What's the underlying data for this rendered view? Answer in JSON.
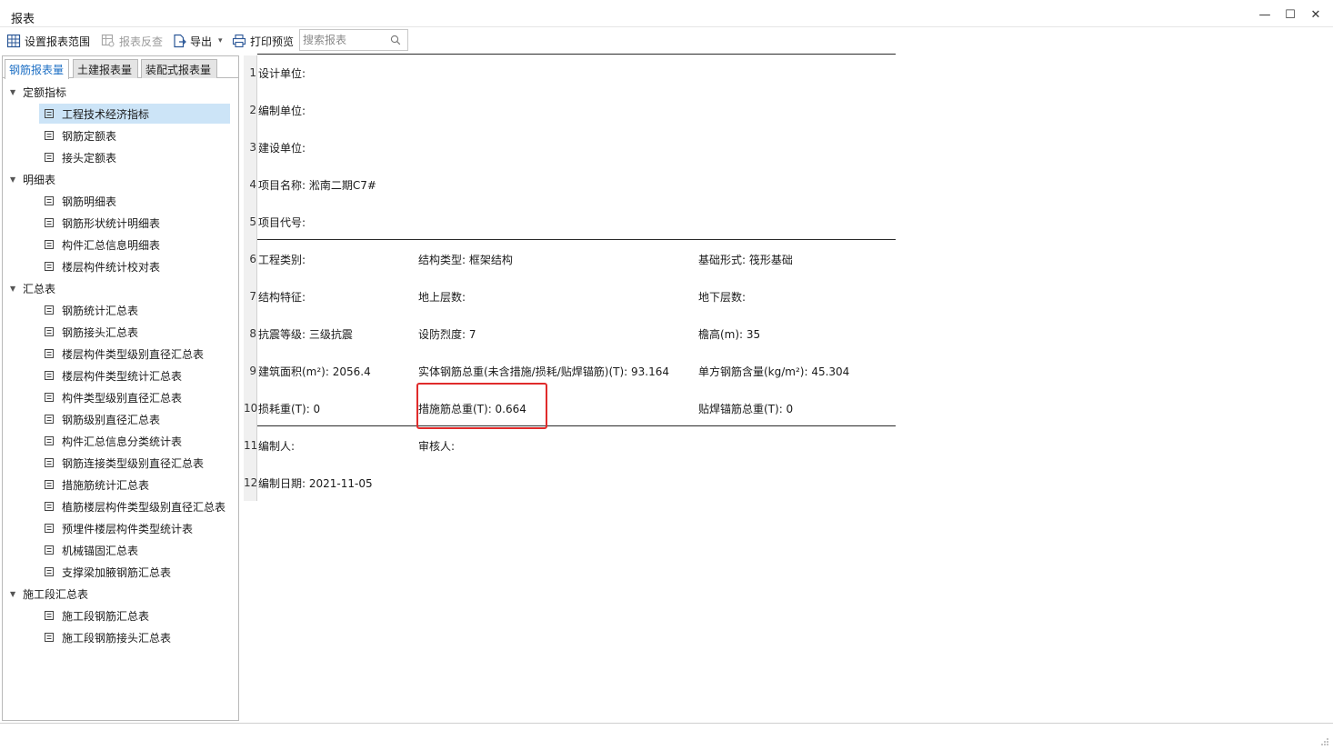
{
  "window": {
    "title": "报表",
    "min_label": "—",
    "max_label": "☐",
    "close_label": "✕"
  },
  "toolbar": {
    "set_range": "设置报表范围",
    "reverse_check": "报表反查",
    "export": "导出",
    "export_caret": "▾",
    "print_preview": "打印预览",
    "search_placeholder": "搜索报表"
  },
  "tabs": [
    {
      "label": "钢筋报表量",
      "active": true
    },
    {
      "label": "土建报表量",
      "active": false
    },
    {
      "label": "装配式报表量",
      "active": false
    }
  ],
  "tree": {
    "groups": [
      {
        "label": "定额指标",
        "items": [
          "工程技术经济指标",
          "钢筋定额表",
          "接头定额表"
        ]
      },
      {
        "label": "明细表",
        "items": [
          "钢筋明细表",
          "钢筋形状统计明细表",
          "构件汇总信息明细表",
          "楼层构件统计校对表"
        ]
      },
      {
        "label": "汇总表",
        "items": [
          "钢筋统计汇总表",
          "钢筋接头汇总表",
          "楼层构件类型级别直径汇总表",
          "楼层构件类型统计汇总表",
          "构件类型级别直径汇总表",
          "钢筋级别直径汇总表",
          "构件汇总信息分类统计表",
          "钢筋连接类型级别直径汇总表",
          "措施筋统计汇总表",
          "植筋楼层构件类型级别直径汇总表",
          "预埋件楼层构件类型统计表",
          "机械锚固汇总表",
          "支撑梁加腋钢筋汇总表"
        ]
      },
      {
        "label": "施工段汇总表",
        "items": [
          "施工段钢筋汇总表",
          "施工段钢筋接头汇总表"
        ]
      }
    ],
    "selected": "工程技术经济指标"
  },
  "report": {
    "row_numbers": [
      "1",
      "2",
      "3",
      "4",
      "5",
      "6",
      "7",
      "8",
      "9",
      "10",
      "11",
      "12"
    ],
    "r1_c1": "设计单位:",
    "r2_c1": "编制单位:",
    "r3_c1": "建设单位:",
    "r4_c1": "项目名称: 淞南二期C7#",
    "r5_c1": "项目代号:",
    "r6_c1": "工程类别:",
    "r6_c2": "结构类型: 框架结构",
    "r6_c3": "基础形式: 筏形基础",
    "r7_c1": "结构特征:",
    "r7_c2": "地上层数:",
    "r7_c3": "地下层数:",
    "r8_c1": "抗震等级: 三级抗震",
    "r8_c2": "设防烈度: 7",
    "r8_c3": "檐高(m): 35",
    "r9_c1": "建筑面积(m²): 2056.4",
    "r9_c2": "实体钢筋总重(未含措施/损耗/贴焊锚筋)(T): 93.164",
    "r9_c3": "单方钢筋含量(kg/m²): 45.304",
    "r10_c1": "损耗重(T): 0",
    "r10_c2": "措施筋总重(T): 0.664",
    "r10_c3": "贴焊锚筋总重(T): 0",
    "r11_c1": "编制人:",
    "r11_c2": "审核人:",
    "r12_c1": "编制日期: 2021-11-05"
  },
  "colors": {
    "accent": "#1d6fc4",
    "selection": "#cce4f7",
    "highlight_border": "#e02b2b"
  },
  "icons": {
    "set_range": "grid-settings-icon",
    "reverse_check": "grid-search-icon",
    "export": "export-icon",
    "print_preview": "print-preview-icon",
    "search": "search-icon",
    "tree_leaf": "document-icon"
  }
}
